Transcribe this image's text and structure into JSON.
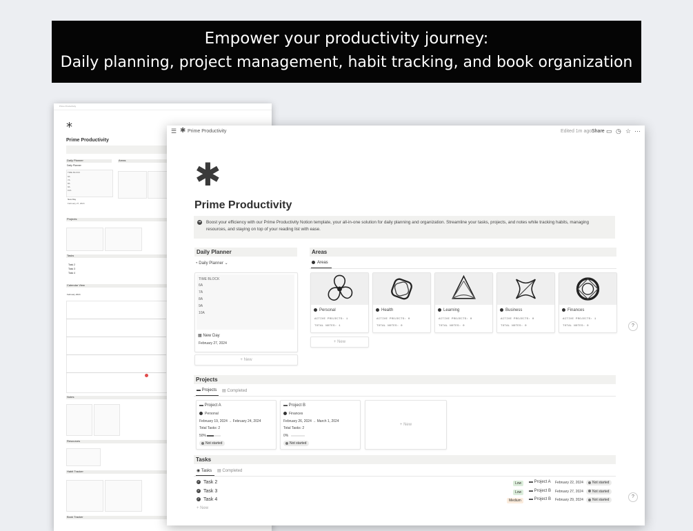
{
  "banner": {
    "line1": "Empower your productivity journey:",
    "line2": "Daily planning, project management, habit tracking, and book organization"
  },
  "back_window": {
    "breadcrumb": "Prime Productivity",
    "title": "Prime Productivity",
    "sections": [
      "Daily Planner",
      "Areas",
      "Projects",
      "Tasks",
      "Calendar View",
      "Notes",
      "Resources",
      "Habit Tracker",
      "Book Tracker"
    ],
    "daily_planner": {
      "view": "Daily Planner",
      "time_block": "TIME BLOCK",
      "hours": [
        "6A",
        "7A",
        "8A",
        "9A",
        "10A"
      ],
      "new_day": "New Day",
      "date": "February 27, 2024"
    },
    "tasks": [
      "Task 2",
      "Task 3",
      "Task 4"
    ],
    "calendar_month": "February 2024"
  },
  "topbar": {
    "breadcrumb": "Prime Productivity",
    "edited": "Edited 1m ago",
    "share": "Share"
  },
  "page": {
    "title": "Prime Productivity",
    "description": "Boost your efficiency with our Prime Productivity Notion template, your all-in-one solution for daily planning and organization. Streamline your tasks, projects, and notes while tracking habits, managing resources, and staying on top of your reading list with ease."
  },
  "daily_planner": {
    "heading": "Daily Planner",
    "view_label": "Daily Planner",
    "time_block": "TIME BLOCK",
    "hours": [
      "6A",
      "7A",
      "8A",
      "9A",
      "10A"
    ],
    "new_day": "New Day",
    "date": "February 27, 2024",
    "new_label": "+ New"
  },
  "areas": {
    "heading": "Areas",
    "tab": "Areas",
    "active_label": "ACTIVE PROJECTS:",
    "notes_label": "TOTAL NOTES:",
    "items": [
      {
        "name": "Personal",
        "active": "1",
        "notes": "1"
      },
      {
        "name": "Health",
        "active": "0",
        "notes": "0"
      },
      {
        "name": "Learning",
        "active": "0",
        "notes": "0"
      },
      {
        "name": "Business",
        "active": "0",
        "notes": "0"
      },
      {
        "name": "Finances",
        "active": "1",
        "notes": "0"
      }
    ],
    "new_label": "+ New"
  },
  "projects": {
    "heading": "Projects",
    "tabs": [
      "Projects",
      "Completed"
    ],
    "total_label": "Total Tasks:",
    "items": [
      {
        "name": "Project A",
        "area": "Personal",
        "dates": "February 19, 2024 → February 24, 2024",
        "total": "2",
        "progress_label": "50%",
        "progress": 0.5,
        "status": "Not started"
      },
      {
        "name": "Project B",
        "area": "Finances",
        "dates": "February 26, 2024 → March 1, 2024",
        "total": "2",
        "progress_label": "0%",
        "progress": 0,
        "status": "Not started"
      }
    ],
    "new_label": "+ New"
  },
  "tasks": {
    "heading": "Tasks",
    "tabs": [
      "Tasks",
      "Completed"
    ],
    "items": [
      {
        "name": "Task 2",
        "priority": "Low",
        "project": "Project A",
        "date": "February 22, 2024",
        "status": "Not started"
      },
      {
        "name": "Task 3",
        "priority": "Low",
        "project": "Project B",
        "date": "February 27, 2024",
        "status": "Not started"
      },
      {
        "name": "Task 4",
        "priority": "Medium",
        "project": "Project B",
        "date": "February 29, 2024",
        "status": "Not started"
      }
    ],
    "new_label": "+ New"
  },
  "help_label": "?",
  "colors": {
    "banner_bg": "#050505",
    "low": "#dbeddb",
    "medium": "#fbecdd",
    "pill": "#ebebea"
  }
}
